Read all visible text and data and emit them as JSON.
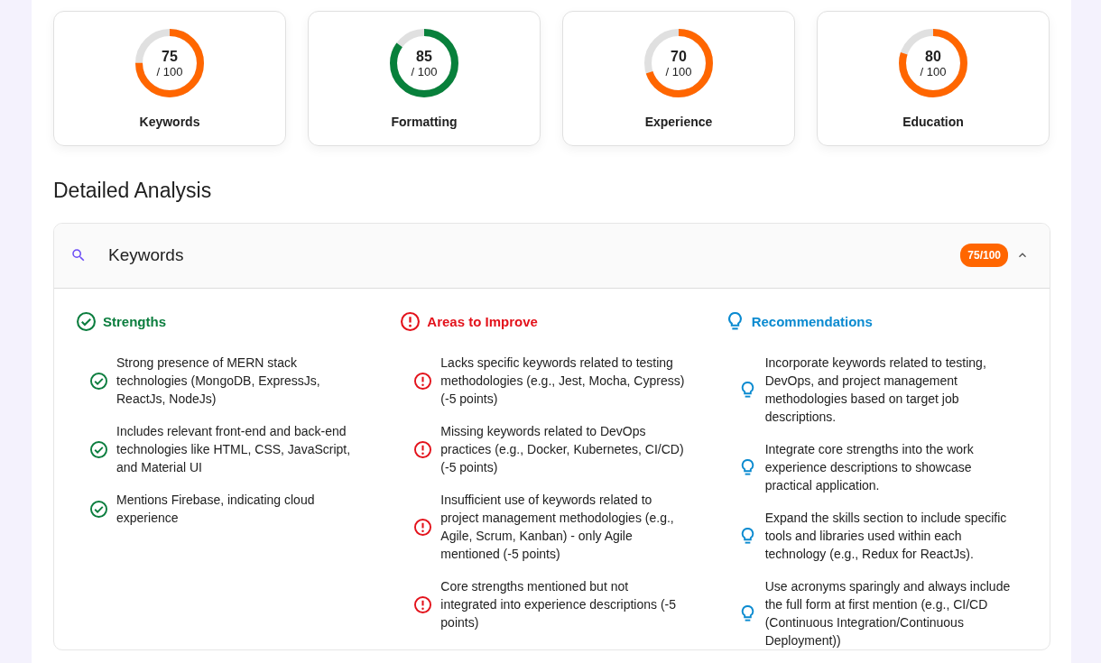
{
  "score_cards": [
    {
      "value": "75",
      "out_of": "/ 100",
      "label": "Keywords",
      "level": 0.75,
      "color": "#ff6600"
    },
    {
      "value": "85",
      "out_of": "/ 100",
      "label": "Formatting",
      "level": 0.85,
      "color": "#08803b"
    },
    {
      "value": "70",
      "out_of": "/ 100",
      "label": "Experience",
      "level": 0.7,
      "color": "#ff6600"
    },
    {
      "value": "80",
      "out_of": "/ 100",
      "label": "Education",
      "level": 0.8,
      "color": "#ff6600"
    }
  ],
  "section_title": "Detailed Analysis",
  "accordion": {
    "title": "Keywords",
    "badge": "75/100",
    "expanded": true,
    "columns": [
      {
        "kind": "strengths",
        "title": "Strengths",
        "items": [
          "Strong presence of MERN stack technologies (MongoDB, ExpressJs, ReactJs, NodeJs)",
          "Includes relevant front-end and back-end technologies like HTML, CSS, JavaScript, and Material UI",
          "Mentions Firebase, indicating cloud experience"
        ]
      },
      {
        "kind": "improve",
        "title": "Areas to Improve",
        "items": [
          "Lacks specific keywords related to testing methodologies (e.g., Jest, Mocha, Cypress) (-5 points)",
          "Missing keywords related to DevOps practices (e.g., Docker, Kubernetes, CI/CD) (-5 points)",
          "Insufficient use of keywords related to project management methodologies (e.g., Agile, Scrum, Kanban) - only Agile mentioned (-5 points)",
          "Core strengths mentioned but not integrated into experience descriptions (-5 points)"
        ]
      },
      {
        "kind": "recommendations",
        "title": "Recommendations",
        "items": [
          "Incorporate keywords related to testing, DevOps, and project management methodologies based on target job descriptions.",
          "Integrate core strengths into the work experience descriptions to showcase practical application.",
          "Expand the skills section to include specific tools and libraries used within each technology (e.g., Redux for ReactJs).",
          "Use acronyms sparingly and always include the full form at first mention (e.g., CI/CD (Continuous Integration/Continuous Deployment))"
        ]
      }
    ]
  }
}
